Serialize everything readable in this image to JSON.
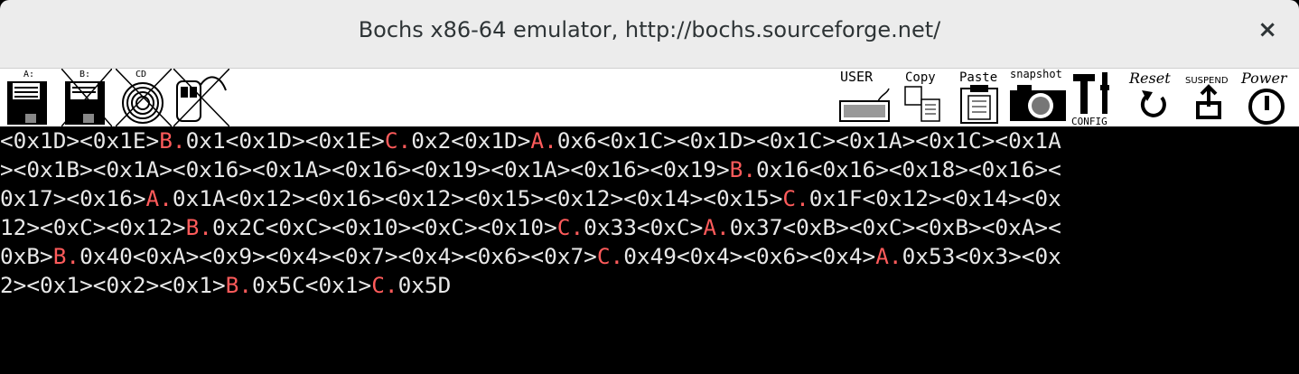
{
  "window": {
    "title": "Bochs x86-64 emulator, http://bochs.sourceforge.net/",
    "close_glyph": "×"
  },
  "toolbar": {
    "floppy_a_label": "A:",
    "floppy_b_label": "B:",
    "cdrom_label": "CD",
    "user_label": "USER",
    "copy_label": "Copy",
    "paste_label": "Paste",
    "snapshot_label": "snapshot",
    "config_label": "CONFIG",
    "reset_label": "Reset",
    "suspend_label": "SUSPEND",
    "power_label": "Power"
  },
  "colors": {
    "highlight": "#ff5b5b",
    "text": "#e8e8e8",
    "background": "#000000"
  },
  "screen": {
    "lines": [
      [
        {
          "t": "<0x1D><0x1E>"
        },
        {
          "t": "B.",
          "hl": true
        },
        {
          "t": "0x1<0x1D><0x1E>"
        },
        {
          "t": "C.",
          "hl": true
        },
        {
          "t": "0x2<0x1D>"
        },
        {
          "t": "A.",
          "hl": true
        },
        {
          "t": "0x6<0x1C><0x1D><0x1C><0x1A><0x1C><0x1A"
        }
      ],
      [
        {
          "t": "><0x1B><0x1A><0x16><0x1A><0x16><0x19><0x1A><0x16><0x19>"
        },
        {
          "t": "B.",
          "hl": true
        },
        {
          "t": "0x16<0x16><0x18><0x16><"
        }
      ],
      [
        {
          "t": "0x17><0x16>"
        },
        {
          "t": "A.",
          "hl": true
        },
        {
          "t": "0x1A<0x12><0x16><0x12><0x15><0x12><0x14><0x15>"
        },
        {
          "t": "C.",
          "hl": true
        },
        {
          "t": "0x1F<0x12><0x14><0x"
        }
      ],
      [
        {
          "t": "12><0xC><0x12>"
        },
        {
          "t": "B.",
          "hl": true
        },
        {
          "t": "0x2C<0xC><0x10><0xC><0x10>"
        },
        {
          "t": "C.",
          "hl": true
        },
        {
          "t": "0x33<0xC>"
        },
        {
          "t": "A.",
          "hl": true
        },
        {
          "t": "0x37<0xB><0xC><0xB><0xA><"
        }
      ],
      [
        {
          "t": "0xB>"
        },
        {
          "t": "B.",
          "hl": true
        },
        {
          "t": "0x40<0xA><0x9><0x4><0x7><0x4><0x6><0x7>"
        },
        {
          "t": "C.",
          "hl": true
        },
        {
          "t": "0x49<0x4><0x6><0x4>"
        },
        {
          "t": "A.",
          "hl": true
        },
        {
          "t": "0x53<0x3><0x"
        }
      ],
      [
        {
          "t": "2><0x1><0x2><0x1>"
        },
        {
          "t": "B.",
          "hl": true
        },
        {
          "t": "0x5C<0x1>"
        },
        {
          "t": "C.",
          "hl": true
        },
        {
          "t": "0x5D"
        }
      ]
    ]
  }
}
